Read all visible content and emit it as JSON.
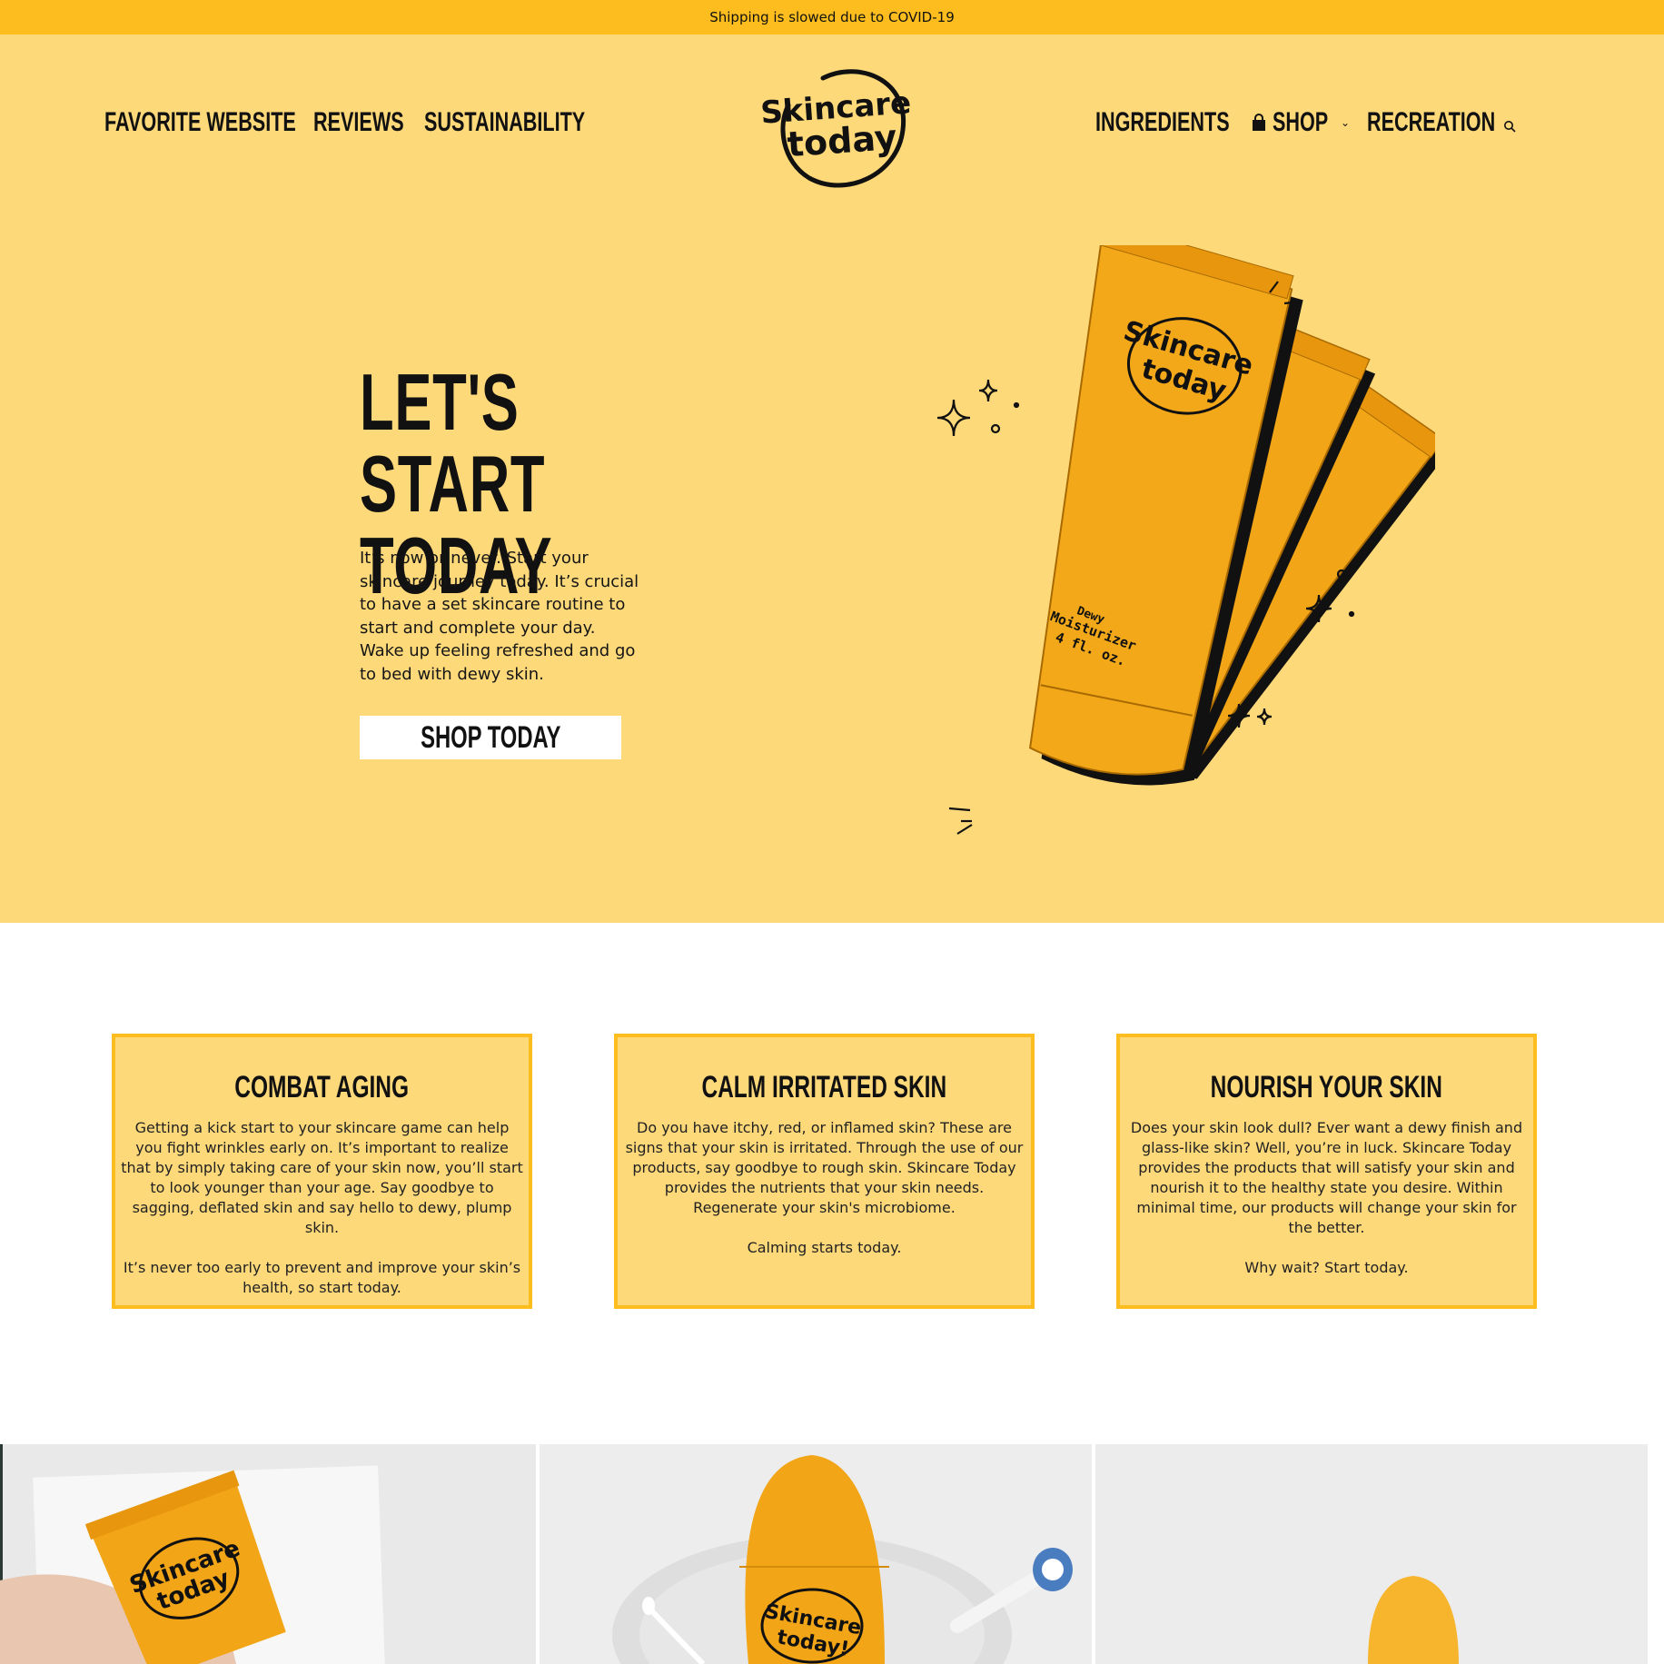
{
  "announcement": {
    "text": "Shipping is slowed due to COVID-19"
  },
  "nav": {
    "left": [
      {
        "label": "FAVORITE WEBSITE",
        "has_dropdown": true
      },
      {
        "label": "REVIEWS"
      },
      {
        "label": "SUSTAINABILITY"
      }
    ],
    "right": [
      {
        "label": "INGREDIENTS"
      },
      {
        "label": "SHOP",
        "has_dropdown": true,
        "icon": "shopping-bag-icon"
      },
      {
        "label": "RECREATION"
      }
    ],
    "search_icon": "search-icon",
    "dropdown_caret": "⌄"
  },
  "logo": {
    "line1": "Skincare",
    "line2": "today"
  },
  "hero": {
    "title_line1": "LET'S START",
    "title_line2": "TODAY",
    "text": "It’s now or never. Start your skincare journey today. It’s crucial to have a set skincare routine to start and complete your day. Wake up feeling refreshed and go to bed with dewy skin.",
    "cta": "SHOP TODAY"
  },
  "product": {
    "brand_line1": "Skincare",
    "brand_line2": "today",
    "name_line1": "Dewy",
    "name_line2": "Moisturizer",
    "name_line3": "4 fl. oz."
  },
  "cards": [
    {
      "title": "COMBAT AGING",
      "text": "Getting a kick start to your skincare game can help you fight wrinkles early on. It’s important to realize that by simply taking care of your skin now, you’ll start to look younger than your age. Say goodbye to sagging, deflated skin and say hello to dewy, plump skin.",
      "sub": "It’s never too early to prevent and improve your skin’s health, so start today."
    },
    {
      "title": "CALM IRRITATED SKIN",
      "text": "Do you have itchy, red, or inflamed skin? These are signs that your skin is irritated. Through the use of our products, say goodbye to rough skin. Skincare Today provides the nutrients that your skin needs. Regenerate your skin's microbiome.",
      "sub": "Calming starts today."
    },
    {
      "title": "NOURISH YOUR SKIN",
      "text": "Does your skin look dull? Ever want a dewy finish and glass-like skin? Well, you’re in luck. Skincare Today provides the products that will satisfy your skin and nourish it to the healthy state you desire. Within minimal time, our products will change your skin for the better.",
      "sub": "Why wait? Start today."
    }
  ],
  "photos": [
    {
      "label_line1": "Skincare",
      "label_line2": "today"
    },
    {
      "label_line1": "Skincare",
      "label_line2": "today!"
    },
    {
      "label_line1": "",
      "label_line2": ""
    }
  ],
  "colors": {
    "announcement_bg": "#fdbd1e",
    "hero_bg": "#fed97a",
    "card_border": "#fdbd1e",
    "tube": "#f2a516"
  }
}
